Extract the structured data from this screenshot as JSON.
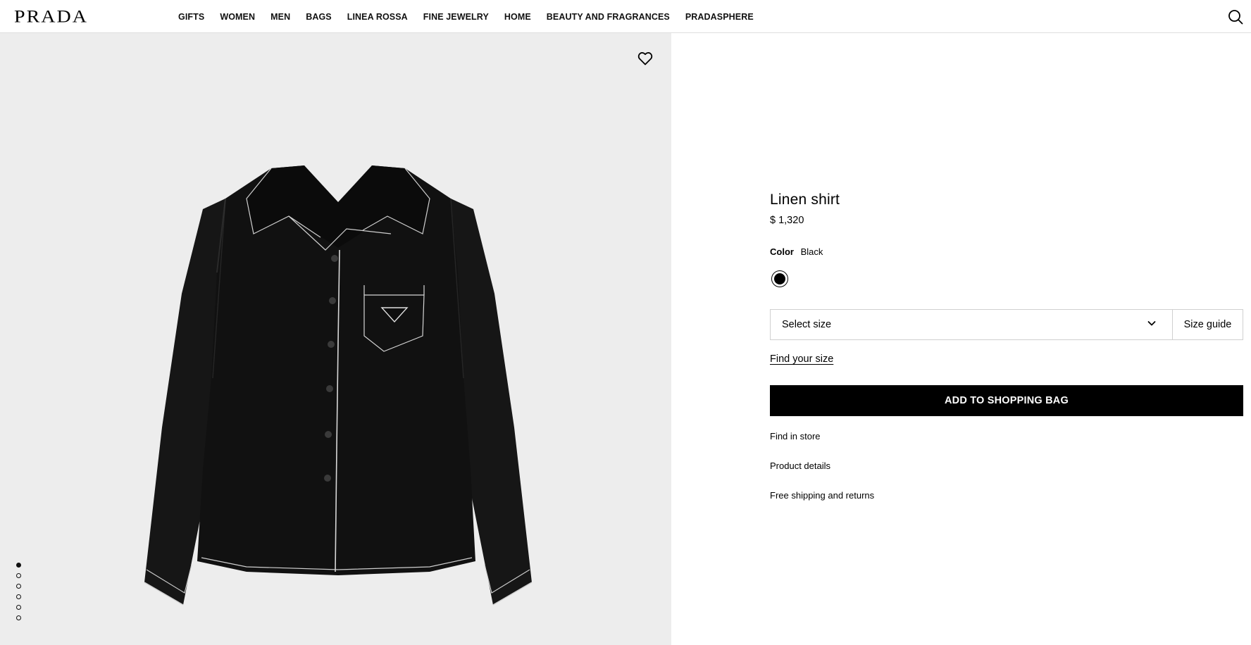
{
  "header": {
    "logo": "PRADA",
    "nav": [
      {
        "label": "GIFTS"
      },
      {
        "label": "WOMEN"
      },
      {
        "label": "MEN"
      },
      {
        "label": "BAGS"
      },
      {
        "label": "LINEA ROSSA"
      },
      {
        "label": "FINE JEWELRY"
      },
      {
        "label": "HOME"
      },
      {
        "label": "BEAUTY AND FRAGRANCES"
      },
      {
        "label": "PRADASPHERE"
      }
    ],
    "search_icon": "search-icon"
  },
  "gallery": {
    "wishlist_icon": "heart-icon",
    "image_count": 6,
    "active_image": 1,
    "background": "#ededed"
  },
  "product": {
    "title": "Linen shirt",
    "price": "$ 1,320",
    "color_label": "Color",
    "color_value": "Black",
    "swatch_color": "#000000",
    "size_placeholder": "Select size",
    "size_guide": "Size guide",
    "find_size": "Find your size",
    "add_to_bag": "ADD TO SHOPPING BAG",
    "find_in_store": "Find in store",
    "product_details": "Product details",
    "shipping": "Free shipping and returns"
  }
}
